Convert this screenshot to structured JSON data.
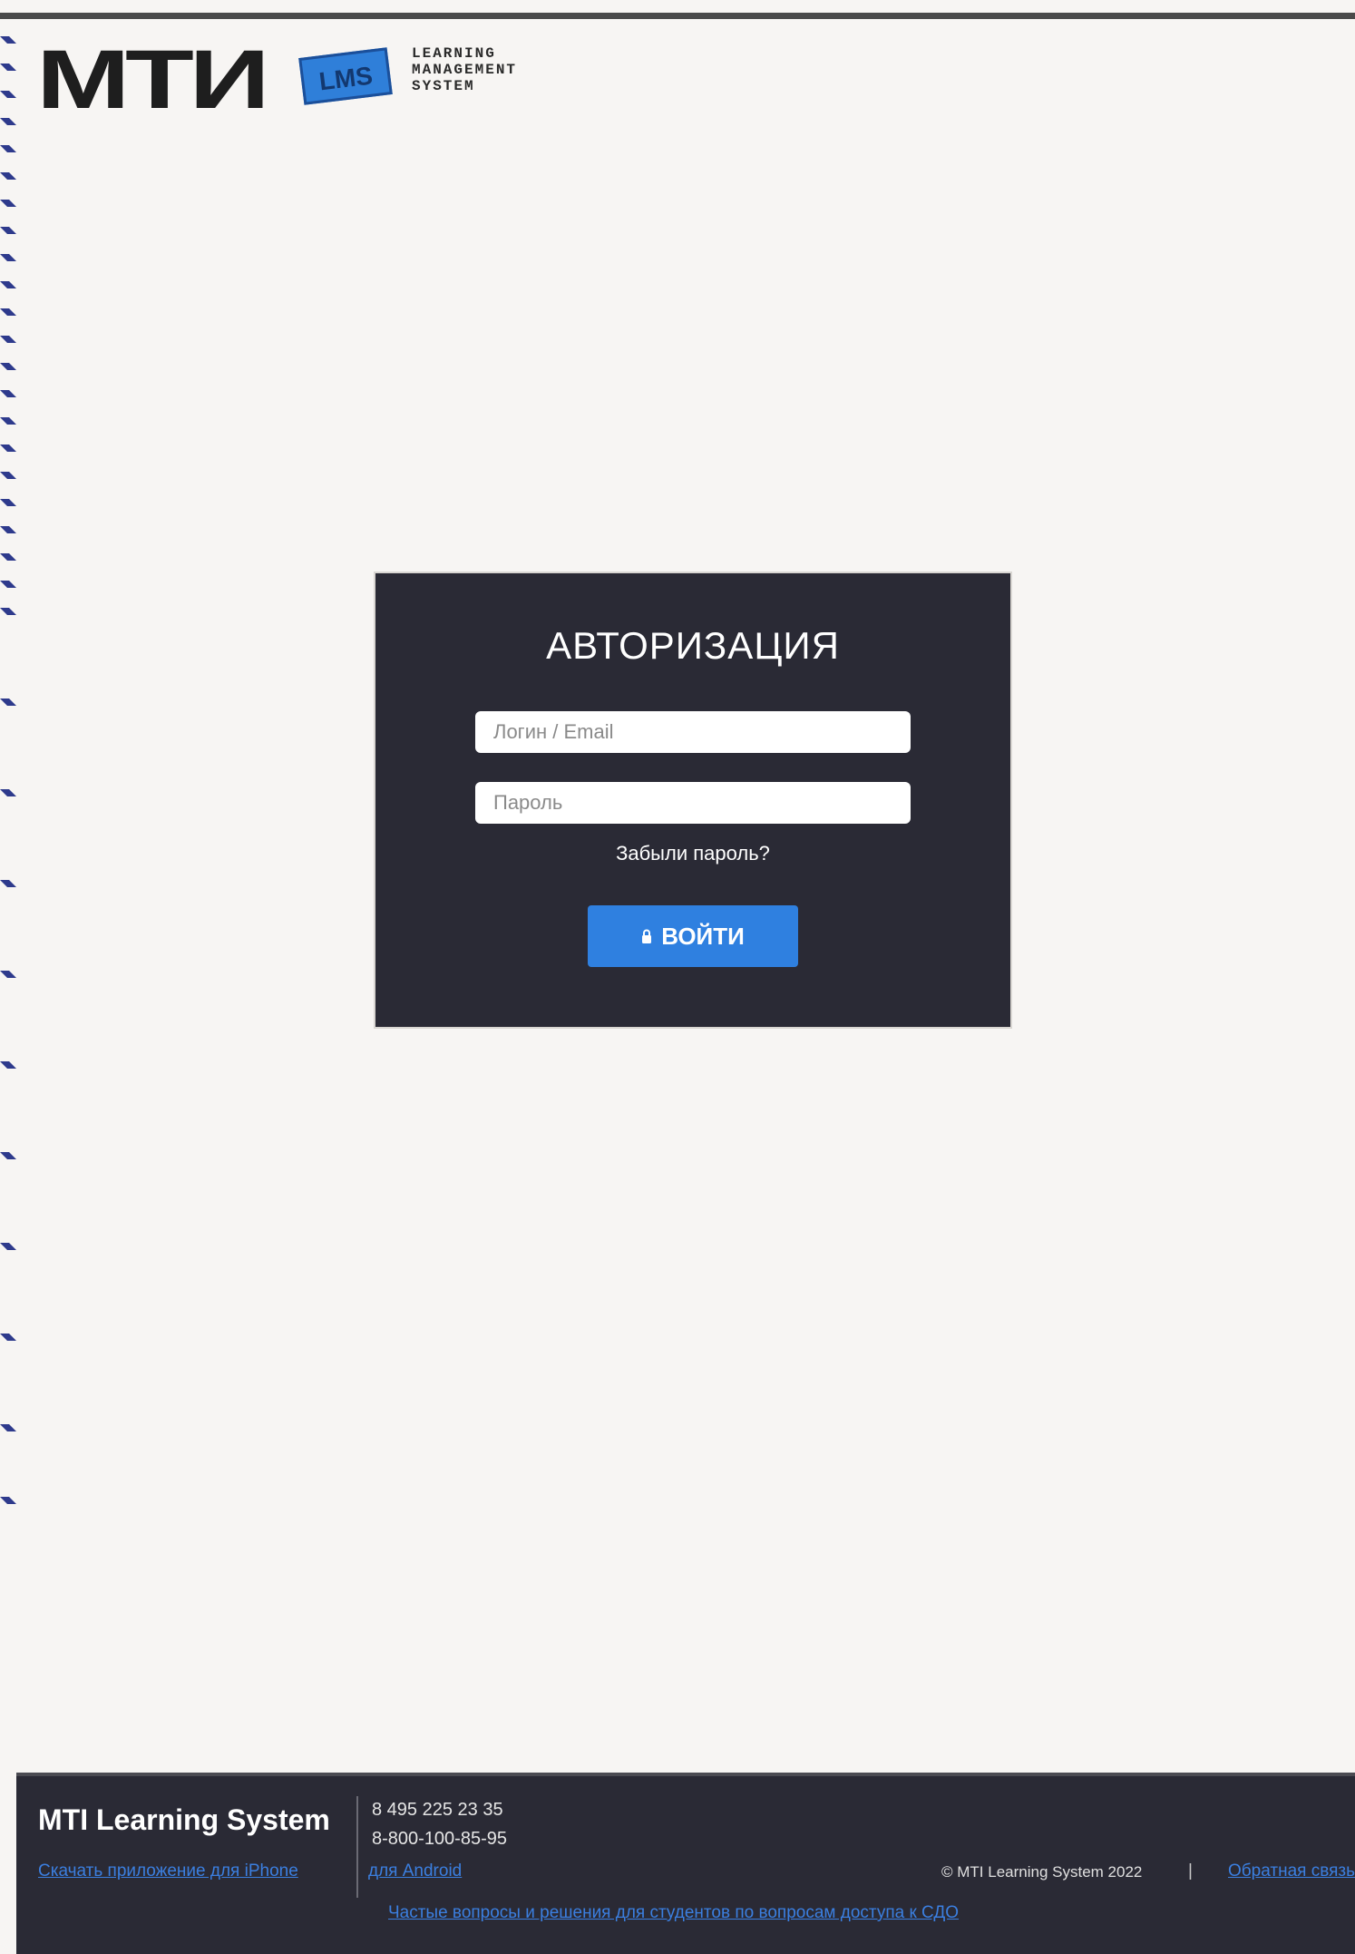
{
  "logo": {
    "mark": "МТИ",
    "badge": "LMS",
    "tagline": [
      "LEARNING",
      "MANAGEMENT",
      "SYSTEM"
    ]
  },
  "login": {
    "title": "АВТОРИЗАЦИЯ",
    "login_placeholder": "Логин / Email",
    "password_placeholder": "Пароль",
    "forgot_label": "Забыли пароль?",
    "submit_label": "ВОЙТИ"
  },
  "footer": {
    "brand": "MTI Learning System",
    "phones": [
      "8 495 225 23 35",
      "8-800-100-85-95"
    ],
    "app_iphone_label": "Скачать приложение для iPhone",
    "app_android_label": "для Android",
    "copyright": "© MTI Learning System 2022",
    "separator": "|",
    "feedback_label": "Обратная связь",
    "faq_label": "Частые вопросы и решения для студентов по вопросам доступа к СДО"
  },
  "colors": {
    "page_bg": "#f7f5f3",
    "card_bg": "#2a2a35",
    "accent": "#2f80e0",
    "footer_bg": "#2a2a35",
    "link": "#3b7fe0"
  }
}
